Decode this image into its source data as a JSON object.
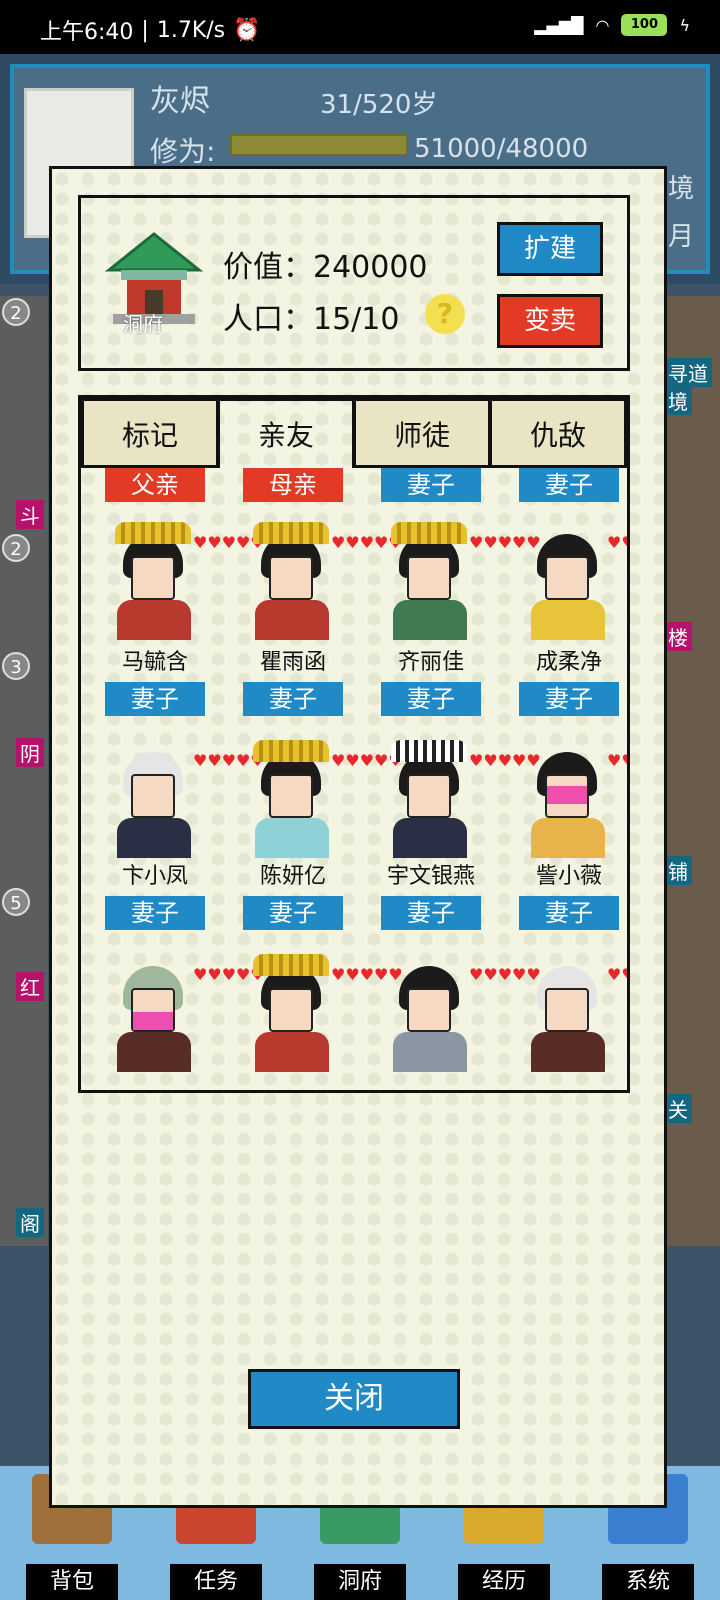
{
  "status_bar": {
    "time": "上午6:40",
    "speed": "1.7K/s",
    "alarm_icon": "alarm-icon",
    "signal_icon": "signal-icon",
    "wifi_icon": "wifi-icon",
    "battery": "100",
    "charging_icon": "charging-icon"
  },
  "background": {
    "player_name": "灰烬",
    "age": "31/520岁",
    "cultivation_label": "修为:",
    "cultivation_value": "51000/48000",
    "right_text_1": "境",
    "right_text_2": "月",
    "side_badges": [
      "2",
      "2",
      "3",
      "5"
    ],
    "side_labels_left": [
      "斗",
      "阴",
      "红",
      "阁"
    ],
    "side_labels_right": [
      "寻道",
      "境",
      "楼",
      "铺",
      "关"
    ]
  },
  "bottom_nav": [
    {
      "label": "背包",
      "icon": "bag-icon"
    },
    {
      "label": "任务",
      "icon": "task-scroll-icon"
    },
    {
      "label": "洞府",
      "icon": "cave-house-icon"
    },
    {
      "label": "经历",
      "icon": "book-icon"
    },
    {
      "label": "系统",
      "icon": "system-gear-icon"
    }
  ],
  "modal": {
    "house_label": "洞府",
    "value_text": "价值：240000",
    "population_text": "人口：15/10",
    "help_symbol": "?",
    "expand_button": "扩建",
    "sell_button": "变卖",
    "tabs": [
      "标记",
      "亲友",
      "师徒",
      "仇敌"
    ],
    "active_tab": "亲友",
    "top_row_badges": [
      {
        "label": "父亲",
        "color": "red"
      },
      {
        "label": "母亲",
        "color": "red"
      },
      {
        "label": "妻子",
        "color": "blue"
      },
      {
        "label": "妻子",
        "color": "blue"
      }
    ],
    "members_row1": [
      {
        "name": "马毓含",
        "relation": "妻子"
      },
      {
        "name": "瞿雨函",
        "relation": "妻子"
      },
      {
        "name": "齐丽佳",
        "relation": "妻子"
      },
      {
        "name": "成柔净",
        "relation": "妻子"
      }
    ],
    "members_row2": [
      {
        "name": "卞小凤",
        "relation": "妻子"
      },
      {
        "name": "陈妍亿",
        "relation": "妻子"
      },
      {
        "name": "宇文银燕",
        "relation": "妻子"
      },
      {
        "name": "訾小薇",
        "relation": "妻子"
      }
    ],
    "close_button": "关闭"
  },
  "colors": {
    "modal_bg": "#f3f4e1",
    "blue_button": "#1f8ac6",
    "red_button": "#e23a24",
    "heart": "#e8282b"
  }
}
